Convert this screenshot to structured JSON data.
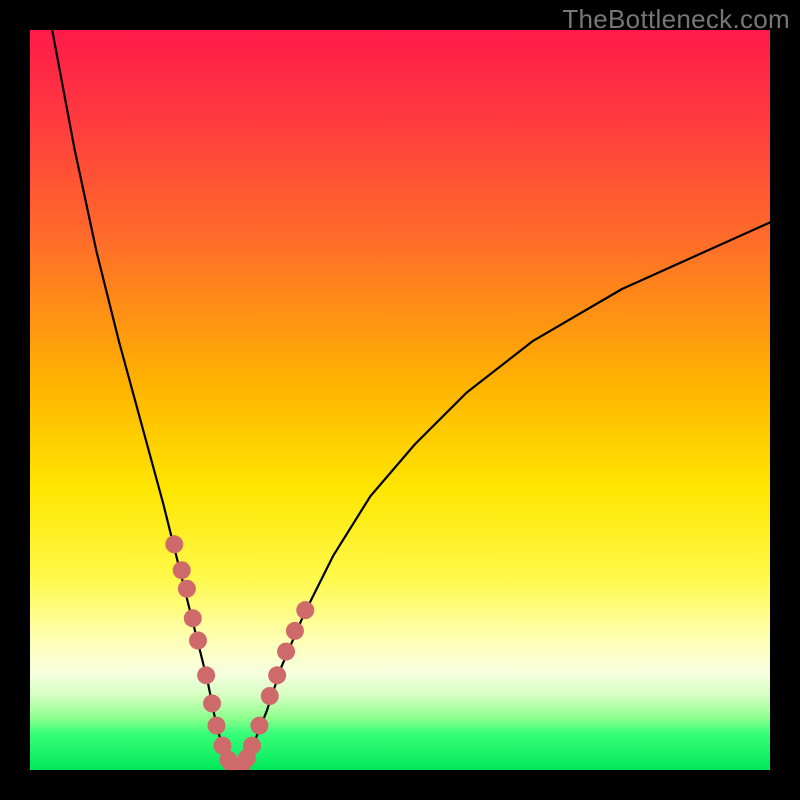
{
  "watermark": "TheBottleneck.com",
  "chart_data": {
    "type": "line",
    "title": "",
    "xlabel": "",
    "ylabel": "",
    "xlim": [
      0,
      100
    ],
    "ylim": [
      0,
      100
    ],
    "grid": false,
    "series": [
      {
        "name": "curve",
        "type": "line",
        "color": "#000000",
        "x": [
          3,
          6,
          9,
          12,
          15,
          18,
          20,
          22,
          24,
          25,
          26,
          27,
          28,
          29,
          30,
          32,
          34,
          37,
          41,
          46,
          52,
          59,
          68,
          80,
          100
        ],
        "y": [
          100,
          84,
          70,
          58,
          47,
          36,
          28,
          20,
          12,
          7,
          3,
          1,
          0,
          1,
          3,
          8,
          14,
          21,
          29,
          37,
          44,
          51,
          58,
          65,
          74
        ]
      },
      {
        "name": "highlight-dots",
        "type": "scatter",
        "color": "#cf6a6a",
        "x": [
          19.5,
          20.5,
          21.2,
          22.0,
          22.7,
          23.8,
          24.6,
          25.2,
          26.0,
          26.8,
          27.4,
          28.0,
          28.6,
          29.3,
          30.0,
          31.0,
          32.4,
          33.4,
          34.6,
          35.8,
          37.2
        ],
        "y": [
          30.5,
          27.0,
          24.5,
          20.5,
          17.5,
          12.8,
          9.0,
          6.0,
          3.3,
          1.4,
          0.6,
          0.3,
          0.6,
          1.6,
          3.3,
          6.0,
          10.0,
          12.8,
          16.0,
          18.8,
          21.6
        ]
      }
    ]
  }
}
